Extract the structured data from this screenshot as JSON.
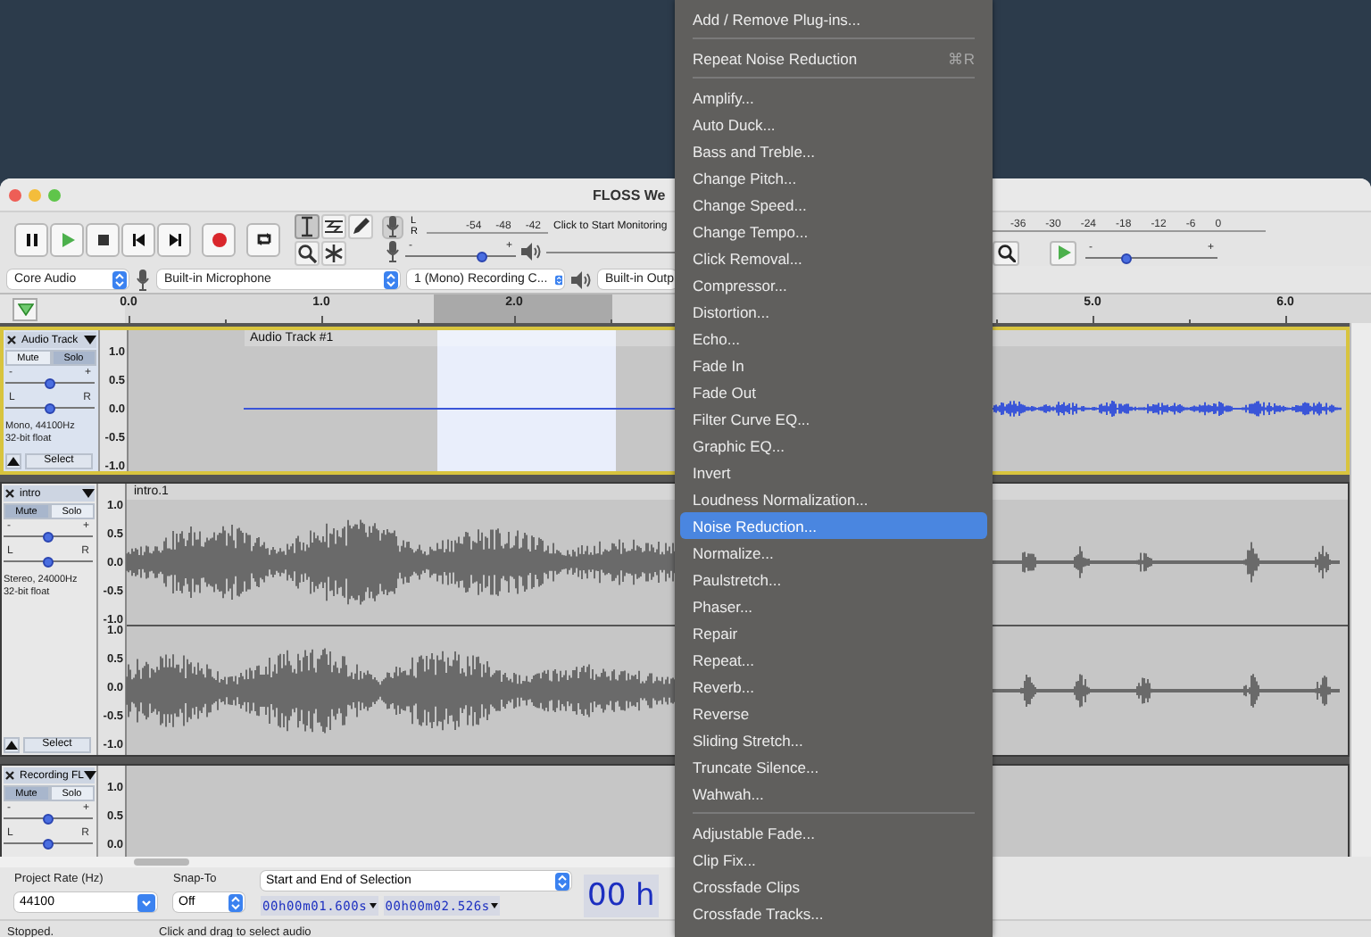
{
  "window": {
    "title": "FLOSS We"
  },
  "transport": [
    {
      "kind": "pause"
    },
    {
      "kind": "play"
    },
    {
      "kind": "stop"
    },
    {
      "kind": "skip_start"
    },
    {
      "kind": "skip_end"
    },
    {
      "kind": "record"
    },
    {
      "kind": "loop"
    }
  ],
  "tools": [
    {
      "kind": "select",
      "selected": true
    },
    {
      "kind": "envelope",
      "selected": false
    },
    {
      "kind": "draw",
      "selected": false
    },
    {
      "kind": "zoom",
      "selected": false
    },
    {
      "kind": "multi",
      "selected": false
    }
  ],
  "record_meter": {
    "channels": [
      "L",
      "R"
    ],
    "scale": [
      "-54",
      "-48",
      "-42"
    ],
    "prompt": "Click to Start Monitoring"
  },
  "recording_volume": {
    "marks": [
      "-",
      "+"
    ],
    "level": 0.69
  },
  "playback_meter": {
    "scale": [
      "-36",
      "-30",
      "-24",
      "-18",
      "-12",
      "-6",
      "0"
    ]
  },
  "play_at_speed": {
    "marks": [
      "-",
      "+"
    ],
    "level": 0.31
  },
  "devices": [
    {
      "kind": "host",
      "value": "Core Audio"
    },
    {
      "kind": "recording_device",
      "value": "Built-in Microphone"
    },
    {
      "kind": "recording_channels",
      "value": "1 (Mono) Recording C..."
    },
    {
      "kind": "playback_device",
      "value": "Built-in Outp"
    }
  ],
  "ruler": {
    "ticks": [
      "0.0",
      "1.0",
      "2.0",
      "5.0",
      "6.0"
    ]
  },
  "tracks": [
    {
      "name": "Audio Track",
      "selected": true,
      "buttons": [
        {
          "label": "Mute",
          "on": false
        },
        {
          "label": "Solo",
          "on": true
        }
      ],
      "gain": {
        "marks": [
          "-",
          "+"
        ],
        "level": 0.5
      },
      "pan": {
        "marks": [
          "L",
          "R"
        ],
        "level": 0.5
      },
      "info": [
        "Mono, 44100Hz",
        "32-bit float"
      ],
      "select": "Select",
      "clip": "Audio Track #1",
      "kind": "flat",
      "channels": [
        {
          "scale": [
            "1.0",
            "0.5",
            "0.0",
            "-0.5",
            "-1.0"
          ]
        }
      ]
    },
    {
      "name": "intro",
      "selected": false,
      "buttons": [
        {
          "label": "Mute",
          "on": true
        },
        {
          "label": "Solo",
          "on": false
        }
      ],
      "gain": {
        "marks": [
          "-",
          "+"
        ],
        "level": 0.5
      },
      "pan": {
        "marks": [
          "L",
          "R"
        ],
        "level": 0.5
      },
      "info": [
        "Stereo, 24000Hz",
        "32-bit float"
      ],
      "select": "Select",
      "clip": "intro.1",
      "kind": "speech",
      "channels": [
        {
          "scale": [
            "1.0",
            "0.5",
            "0.0",
            "-0.5",
            "-1.0"
          ]
        },
        {
          "scale": [
            "1.0",
            "0.5",
            "0.0",
            "-0.5",
            "-1.0"
          ]
        }
      ]
    },
    {
      "name": "Recording FL",
      "selected": false,
      "buttons": [
        {
          "label": "Mute",
          "on": true
        },
        {
          "label": "Solo",
          "on": false
        }
      ],
      "gain": {
        "marks": [
          "-",
          "+"
        ],
        "level": 0.5
      },
      "pan": {
        "marks": [
          "L",
          "R"
        ],
        "level": 0.5
      },
      "kind": "empty",
      "channels": [
        {
          "scale": [
            "1.0",
            "0.5",
            "0.0"
          ]
        }
      ]
    }
  ],
  "selection_toolbar": {
    "rate": {
      "label": "Project Rate (Hz)",
      "value": "44100"
    },
    "snap": {
      "label": "Snap-To",
      "value": "Off"
    },
    "format": "Start and End of Selection",
    "start": "00h00m01.600s",
    "end": "00h00m02.526s",
    "position": "00 h"
  },
  "status_bar": {
    "state": "Stopped.",
    "hint": "Click and drag to select audio"
  },
  "menu": {
    "items": [
      {
        "kind": "item",
        "label": "Add / Remove Plug-ins...",
        "selected": false
      },
      {
        "kind": "separator"
      },
      {
        "kind": "item",
        "label": "Repeat Noise Reduction",
        "shortcut": "⌘R",
        "selected": false
      },
      {
        "kind": "separator"
      },
      {
        "kind": "item",
        "label": "Amplify...",
        "selected": false
      },
      {
        "kind": "item",
        "label": "Auto Duck...",
        "selected": false
      },
      {
        "kind": "item",
        "label": "Bass and Treble...",
        "selected": false
      },
      {
        "kind": "item",
        "label": "Change Pitch...",
        "selected": false
      },
      {
        "kind": "item",
        "label": "Change Speed...",
        "selected": false
      },
      {
        "kind": "item",
        "label": "Change Tempo...",
        "selected": false
      },
      {
        "kind": "item",
        "label": "Click Removal...",
        "selected": false
      },
      {
        "kind": "item",
        "label": "Compressor...",
        "selected": false
      },
      {
        "kind": "item",
        "label": "Distortion...",
        "selected": false
      },
      {
        "kind": "item",
        "label": "Echo...",
        "selected": false
      },
      {
        "kind": "item",
        "label": "Fade In",
        "selected": false
      },
      {
        "kind": "item",
        "label": "Fade Out",
        "selected": false
      },
      {
        "kind": "item",
        "label": "Filter Curve EQ...",
        "selected": false
      },
      {
        "kind": "item",
        "label": "Graphic EQ...",
        "selected": false
      },
      {
        "kind": "item",
        "label": "Invert",
        "selected": false
      },
      {
        "kind": "item",
        "label": "Loudness Normalization...",
        "selected": false
      },
      {
        "kind": "item",
        "label": "Noise Reduction...",
        "selected": true
      },
      {
        "kind": "item",
        "label": "Normalize...",
        "selected": false
      },
      {
        "kind": "item",
        "label": "Paulstretch...",
        "selected": false
      },
      {
        "kind": "item",
        "label": "Phaser...",
        "selected": false
      },
      {
        "kind": "item",
        "label": "Repair",
        "selected": false
      },
      {
        "kind": "item",
        "label": "Repeat...",
        "selected": false
      },
      {
        "kind": "item",
        "label": "Reverb...",
        "selected": false
      },
      {
        "kind": "item",
        "label": "Reverse",
        "selected": false
      },
      {
        "kind": "item",
        "label": "Sliding Stretch...",
        "selected": false
      },
      {
        "kind": "item",
        "label": "Truncate Silence...",
        "selected": false
      },
      {
        "kind": "item",
        "label": "Wahwah...",
        "selected": false
      },
      {
        "kind": "separator"
      },
      {
        "kind": "item",
        "label": "Adjustable Fade...",
        "selected": false
      },
      {
        "kind": "item",
        "label": "Clip Fix...",
        "selected": false
      },
      {
        "kind": "item",
        "label": "Crossfade Clips",
        "selected": false
      },
      {
        "kind": "item",
        "label": "Crossfade Tracks...",
        "selected": false
      }
    ]
  }
}
